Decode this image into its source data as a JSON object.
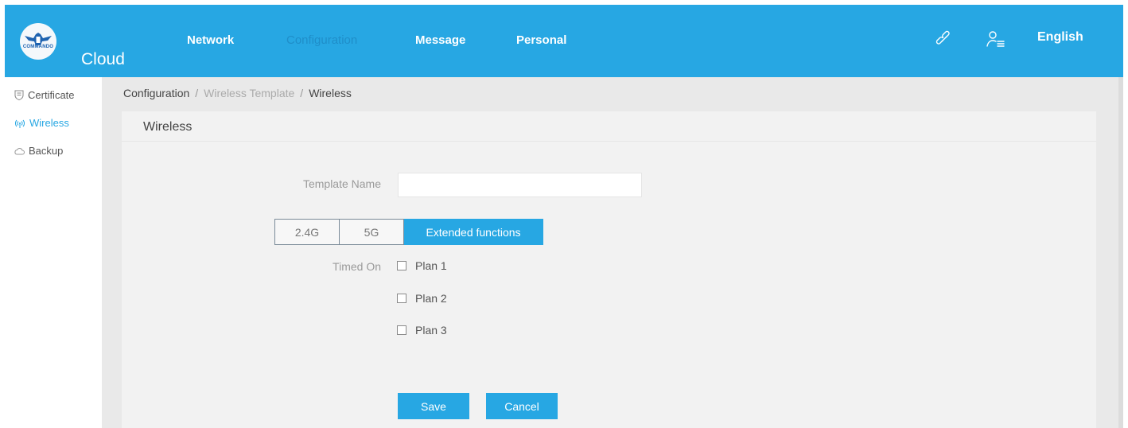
{
  "header": {
    "logo_text": "COMMANDO",
    "brand": "Cloud",
    "nav": [
      {
        "label": "Network",
        "active": false
      },
      {
        "label": "Configuration",
        "active": true
      },
      {
        "label": "Message",
        "active": false
      },
      {
        "label": "Personal",
        "active": false
      }
    ],
    "icons": [
      "link-icon",
      "user-list-icon"
    ],
    "language": "English"
  },
  "sidebar": {
    "items": [
      {
        "label": "Certificate",
        "icon": "shield-icon",
        "active": false
      },
      {
        "label": "Wireless",
        "icon": "wireless-icon",
        "active": true
      },
      {
        "label": "Backup",
        "icon": "cloud-icon",
        "active": false
      }
    ]
  },
  "breadcrumb": {
    "items": [
      "Configuration",
      "Wireless Template",
      "Wireless"
    ],
    "separator": "/"
  },
  "panel": {
    "title": "Wireless",
    "template_name_label": "Template Name",
    "template_name_value": "",
    "tabs": [
      {
        "label": "2.4G",
        "active": false
      },
      {
        "label": "5G",
        "active": false
      },
      {
        "label": "Extended functions",
        "active": true
      }
    ],
    "timed_on_label": "Timed On",
    "plans": [
      {
        "label": "Plan 1",
        "checked": false
      },
      {
        "label": "Plan 2",
        "checked": false
      },
      {
        "label": "Plan 3",
        "checked": false
      }
    ],
    "save_label": "Save",
    "cancel_label": "Cancel"
  },
  "colors": {
    "accent": "#27a7e3",
    "nav_active": "#1f8ec9",
    "background": "#e9e9e9",
    "panel": "#f2f2f2"
  }
}
